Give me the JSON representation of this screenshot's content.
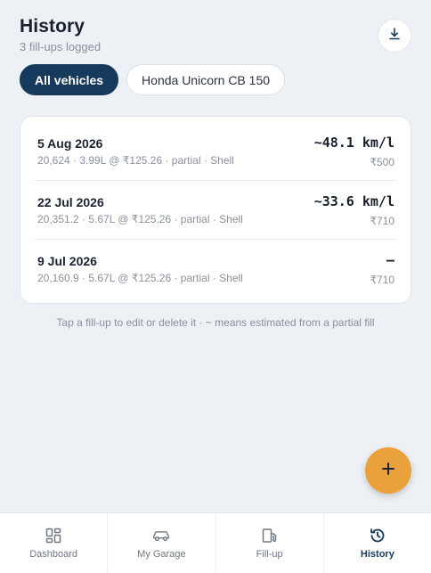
{
  "header": {
    "title": "History",
    "subtitle": "3 fill-ups logged",
    "export_icon": "download-icon"
  },
  "filters": {
    "chips": [
      {
        "label": "All vehicles",
        "active": true
      },
      {
        "label": "Honda Unicorn CB 150",
        "active": false
      }
    ]
  },
  "fillups": [
    {
      "date": "5 Aug 2026",
      "detail": "20,624 · 3.99L @ ₹125.26 · partial · Shell",
      "efficiency": "~48.1 km/l",
      "cost": "₹500"
    },
    {
      "date": "22 Jul 2026",
      "detail": "20,351.2 · 5.67L @ ₹125.26 · partial · Shell",
      "efficiency": "~33.6 km/l",
      "cost": "₹710"
    },
    {
      "date": "9 Jul 2026",
      "detail": "20,160.9 · 5.67L @ ₹125.26 · partial · Shell",
      "efficiency": "–",
      "cost": "₹710"
    }
  ],
  "hint": "Tap a fill-up to edit or delete it · ~ means estimated from a partial fill",
  "fab": {
    "icon": "plus-icon"
  },
  "nav": {
    "items": [
      {
        "label": "Dashboard",
        "icon": "dashboard-icon",
        "active": false
      },
      {
        "label": "My Garage",
        "icon": "car-icon",
        "active": false
      },
      {
        "label": "Fill-up",
        "icon": "fuel-pump-icon",
        "active": false
      },
      {
        "label": "History",
        "icon": "history-icon",
        "active": true
      }
    ]
  },
  "colors": {
    "background": "#edf0f4",
    "primary": "#163a5b",
    "accent": "#e9a23b",
    "muted_text": "#8a919c"
  }
}
